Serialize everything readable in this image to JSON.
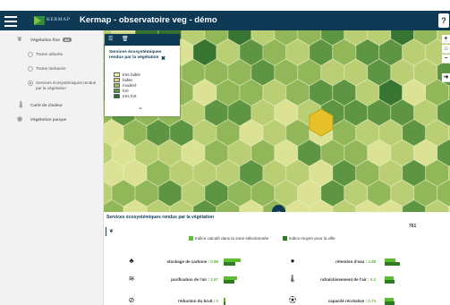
{
  "header": {
    "logo_text": "KERMAP",
    "title": "Kermap - observatoire veg - démo",
    "help_label": "?",
    "colors": {
      "bar": "#0f3a55"
    }
  },
  "sidebar": {
    "vegetation": {
      "label": "Végétation fine",
      "badge": "3/8",
      "icon": "leaf-icon"
    },
    "sub_items": [
      {
        "label": "Trame arborée",
        "selected": false
      },
      {
        "label": "Trame herbacée",
        "selected": false
      },
      {
        "label": "Services écosystémiques rendus par la végétation",
        "selected": true
      }
    ],
    "heat_map": {
      "label": "Carte de chaleur",
      "icon": "thermometer-icon"
    },
    "parks": {
      "label": "Végétation parque",
      "icon": "eye-icon"
    }
  },
  "legend": {
    "title": "Services écosystémiques rendus par la végétation",
    "close": "✖",
    "classes": [
      {
        "label": "très faible",
        "color": "#f3f1a4"
      },
      {
        "label": "faible",
        "color": "#cbd97d"
      },
      {
        "label": "modéré",
        "color": "#98bd5c"
      },
      {
        "label": "fort",
        "color": "#5a9441"
      },
      {
        "label": "très fort",
        "color": "#2c6b2c"
      }
    ]
  },
  "map_controls": [
    "+",
    "⌂",
    "−",
    "➜"
  ],
  "panel": {
    "title": "Services écosystémiques rendus par la végétation",
    "count": "761",
    "legend_zone": {
      "label": "Indice calculé dans la zone sélectionnée",
      "color": "#5bbf2f"
    },
    "legend_city": {
      "label": "indice moyen pour la ville",
      "color": "#2f7a25"
    },
    "metrics": [
      {
        "label": "stockage de carbone : ",
        "value": "0.86",
        "icon": "tree-icon",
        "zone": 0.86,
        "city": 0.6
      },
      {
        "label": "rétention d'eau : ",
        "value": "3.48",
        "icon": "water-drop-icon",
        "zone": 0.55,
        "city": 0.75
      },
      {
        "label": "purification de l'air : ",
        "value": "2.67",
        "icon": "air-icon",
        "zone": 0.7,
        "city": 0.55
      },
      {
        "label": "rafraîchissement de l'air : ",
        "value": "0.3",
        "icon": "thermometer-icon",
        "zone": 0.45,
        "city": 0.5
      },
      {
        "label": "réduction du bruit : ",
        "value": "0",
        "icon": "noise-icon",
        "zone": 0.05,
        "city": 0.08
      },
      {
        "label": "capacité récréative : ",
        "value": "0.73",
        "icon": "football-icon",
        "zone": 0.45,
        "city": 0.5
      }
    ]
  }
}
